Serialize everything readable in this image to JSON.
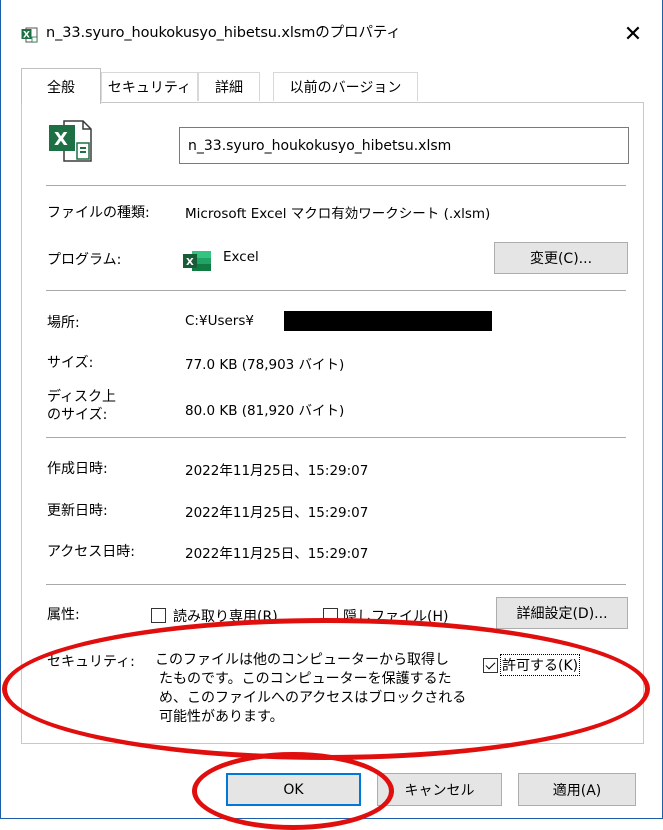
{
  "window": {
    "title": "n_33.syuro_houkokusyo_hibetsu.xlsmのプロパティ",
    "close_glyph": "✕"
  },
  "tabs": [
    {
      "label": "全般",
      "active": true
    },
    {
      "label": "セキュリティ",
      "active": false
    },
    {
      "label": "詳細",
      "active": false
    },
    {
      "label": "以前のバージョン",
      "active": false
    }
  ],
  "general": {
    "file_name": "n_33.syuro_houkokusyo_hibetsu.xlsm",
    "file_type_label": "ファイルの種類:",
    "file_type_value": "Microsoft Excel マクロ有効ワークシート (.xlsm)",
    "program_label": "プログラム:",
    "program_value": "Excel",
    "change_button": "変更(C)...",
    "location_label": "場所:",
    "location_value": "C:¥Users¥",
    "size_label": "サイズ:",
    "size_value": "77.0 KB (78,903 バイト)",
    "disk_size_label_1": "ディスク上",
    "disk_size_label_2": "のサイズ:",
    "disk_size_value": "80.0 KB (81,920 バイト)",
    "created_label": "作成日時:",
    "created_value": "2022年11月25日、15:29:07",
    "modified_label": "更新日時:",
    "modified_value": "2022年11月25日、15:29:07",
    "accessed_label": "アクセス日時:",
    "accessed_value": "2022年11月25日、15:29:07",
    "attributes_label": "属性:",
    "readonly_label": "読み取り専用(R)",
    "readonly_checked": false,
    "hidden_label": "隠しファイル(H)",
    "hidden_checked": false,
    "advanced_button": "詳細設定(D)...",
    "security_label": "セキュリティ:",
    "security_text_lines": [
      "このファイルは他のコンピューターから取得し",
      "たものです。このコンピューターを保護するた",
      "め、このファイルへのアクセスはブロックされる",
      "可能性があります。"
    ],
    "unblock_label": "許可する(K)",
    "unblock_checked": true
  },
  "footer": {
    "ok_button": "OK",
    "cancel_button": "キャンセル",
    "apply_button": "適用(A)"
  },
  "annotation_color": "#e10e0e"
}
